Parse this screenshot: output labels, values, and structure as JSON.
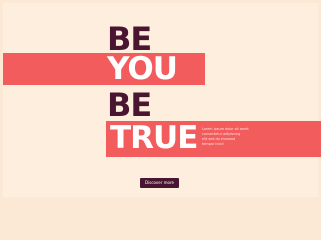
{
  "hero": {
    "words": [
      "BE",
      "YOU",
      "BE",
      "TRUE"
    ],
    "caption_lines": [
      "Lorem ipsum dolor sit amet",
      "consectetur adipiscing",
      "elit sed do eiusmod",
      "tempor incid"
    ]
  },
  "cta": {
    "label": "Discover more"
  },
  "colors": {
    "background": "#fdeedd",
    "accent": "#f25c5c",
    "dark": "#4a1530",
    "light_text": "#ffffff"
  }
}
